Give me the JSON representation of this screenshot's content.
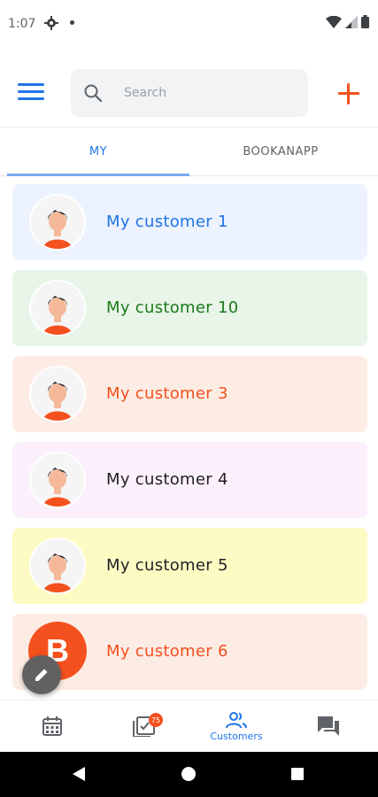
{
  "status_bar": {
    "time": "1:07",
    "icons": [
      "gear-icon",
      "notification-dot",
      "wifi-icon",
      "signal-icon",
      "battery-icon"
    ]
  },
  "header": {
    "menu_icon": "hamburger-menu-icon",
    "search": {
      "placeholder": "Search",
      "value": ""
    },
    "add_icon": "plus-icon"
  },
  "tabs": [
    {
      "label": "MY",
      "selected": true
    },
    {
      "label": "BOOKANAPP",
      "selected": false
    }
  ],
  "customers": [
    {
      "name": "My customer 1",
      "bg": "#ecf2fe",
      "color": "#1e74e8",
      "avatar": "person"
    },
    {
      "name": "My customer 10",
      "bg": "#e8f5e8",
      "color": "#1b7a1b",
      "avatar": "person"
    },
    {
      "name": "My customer 3",
      "bg": "#fdece4",
      "color": "#f4511e",
      "avatar": "person"
    },
    {
      "name": "My customer 4",
      "bg": "#fcf0fc",
      "color": "#202124",
      "avatar": "person"
    },
    {
      "name": "My customer 5",
      "bg": "#fdfbc4",
      "color": "#202124",
      "avatar": "person"
    },
    {
      "name": "My customer 6",
      "bg": "#fdece4",
      "color": "#f4511e",
      "avatar": "B"
    }
  ],
  "fab": {
    "icon": "pencil-icon"
  },
  "bottom_nav": [
    {
      "icon": "calendar-icon",
      "label": ""
    },
    {
      "icon": "inbox-icon",
      "label": "",
      "badge": "75"
    },
    {
      "icon": "customers-icon",
      "label": "Customers",
      "active": true
    },
    {
      "icon": "chat-icon",
      "label": ""
    }
  ],
  "colors": {
    "accent": "#1e74e8",
    "brand_orange": "#f4511e",
    "fab": "#616161"
  }
}
